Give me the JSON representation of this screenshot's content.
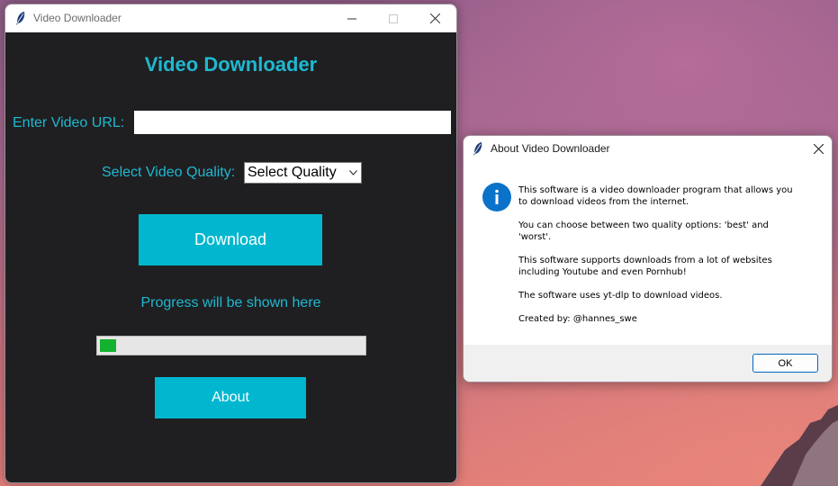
{
  "main_window": {
    "title": "Video Downloader",
    "heading": "Video Downloader",
    "url_label": "Enter Video URL:",
    "url_value": "",
    "quality_label": "Select Video Quality:",
    "quality_selected": "Select Quality",
    "download_label": "Download",
    "progress_text": "Progress will be shown here",
    "progress_fraction": 0.06,
    "about_label": "About",
    "icons": [
      "feather-icon",
      "minimize-icon",
      "maximize-icon",
      "close-icon",
      "chevron-down-icon"
    ]
  },
  "about_dialog": {
    "title": "About Video Downloader",
    "icon": "info-icon",
    "paragraphs": [
      [
        "This software is a video downloader program that allows you",
        "to download videos from the internet."
      ],
      [
        "You can choose between two quality options: 'best' and",
        "'worst'."
      ],
      [
        "This software supports downloads from a lot of websites",
        "including Youtube and even Pornhub!"
      ],
      [
        "The software uses yt-dlp to download videos."
      ],
      [
        "Created by: @hannes_swe"
      ]
    ],
    "ok_label": "OK"
  },
  "colors": {
    "accent": "#00b7cf",
    "accent_text": "#1fb8d0",
    "window_bg": "#1f1f21",
    "progress_fill": "#13b22f",
    "info_blue": "#0a72c9"
  }
}
